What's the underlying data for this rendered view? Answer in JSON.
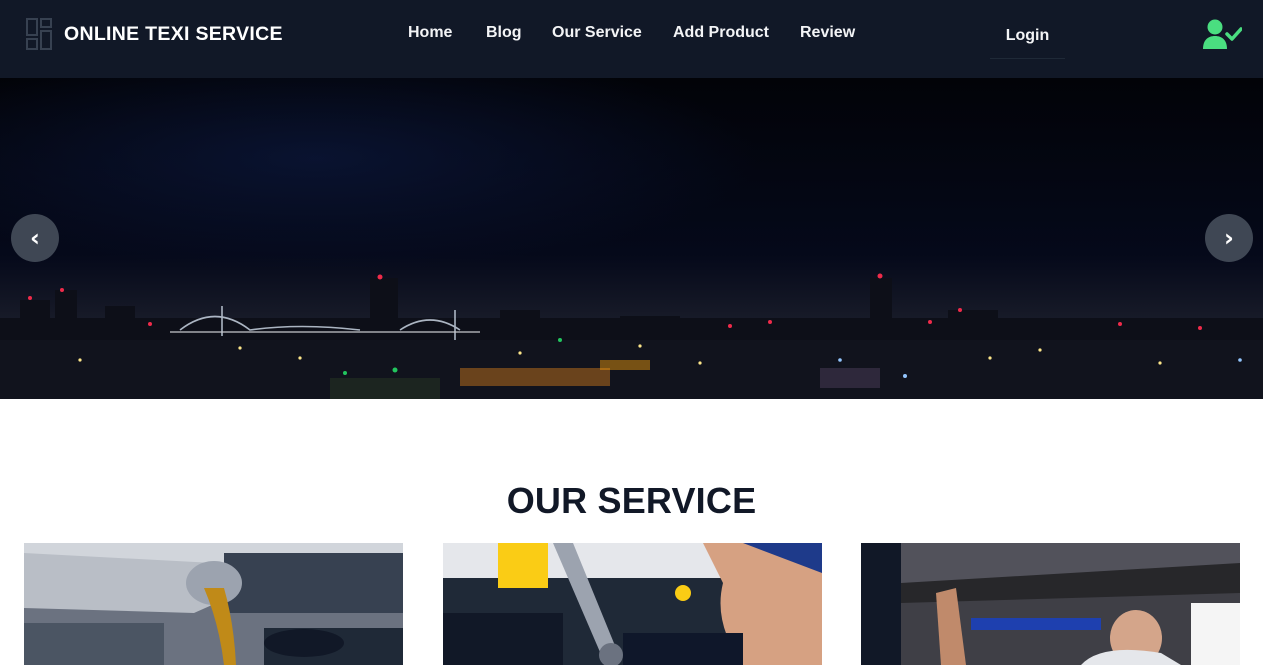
{
  "brand": {
    "name": "ONLINE TEXI SERVICE",
    "logo_icon": "dashboard-grid-icon"
  },
  "nav": {
    "links": [
      {
        "label": "Home"
      },
      {
        "label": "Blog"
      },
      {
        "label": "Our Service"
      },
      {
        "label": "Add Product"
      },
      {
        "label": "Review"
      }
    ],
    "login_label": "Login",
    "user_icon": "user-check-icon",
    "user_icon_color": "#4ade80"
  },
  "hero": {
    "prev_label": "‹",
    "next_label": "›",
    "image": "city-skyline-at-night"
  },
  "services": {
    "title": "OUR SERVICE",
    "cards": [
      {
        "image": "engine-oil-pour"
      },
      {
        "image": "mechanic-wrench-engine"
      },
      {
        "image": "mechanic-under-car"
      }
    ]
  },
  "colors": {
    "navbar_bg": "#111827",
    "title_text": "#111827",
    "slider_button_bg": "#3f4754"
  }
}
